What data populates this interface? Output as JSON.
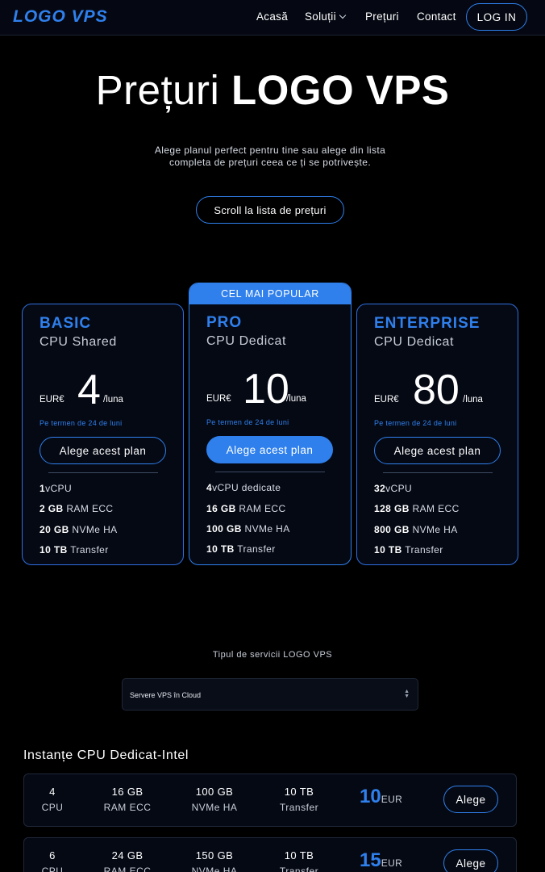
{
  "brand": {
    "logo": "LOGO VPS",
    "accent": "#2f80ed"
  },
  "nav": {
    "items": [
      {
        "label": "Acasă"
      },
      {
        "label": "Soluții"
      },
      {
        "label": "Prețuri"
      },
      {
        "label": "Contact"
      }
    ],
    "login_label": "LOG IN"
  },
  "hero": {
    "title_light": "Prețuri",
    "title_bold": "LOGO VPS",
    "subtitle": "Alege planul perfect pentru tine sau alege din lista completa de prețuri ceea ce ți se potrivește.",
    "scroll_button": "Scroll la lista de prețuri"
  },
  "plans": [
    {
      "name": "BASIC",
      "type": "CPU Shared",
      "currency": "EUR€",
      "price": "4",
      "period": "/luna",
      "term": "Pe termen de 24 de luni",
      "button": "Alege acest plan",
      "features": [
        {
          "value": "1",
          "label": "vCPU"
        },
        {
          "value": "2 GB",
          "label": "RAM ECC"
        },
        {
          "value": "20 GB",
          "label": "NVMe HA"
        },
        {
          "value": "10 TB",
          "label": "Transfer"
        }
      ]
    },
    {
      "badge": "CEL MAI POPULAR",
      "name": "PRO",
      "type": "CPU Dedicat",
      "currency": "EUR€",
      "price": "10",
      "period": "/luna",
      "term": "Pe termen de 24 de luni",
      "button": "Alege acest plan",
      "features": [
        {
          "value": "4",
          "label": "vCPU dedicate"
        },
        {
          "value": "16 GB",
          "label": "RAM ECC"
        },
        {
          "value": "100 GB",
          "label": "NVMe HA"
        },
        {
          "value": "10 TB",
          "label": "Transfer"
        }
      ]
    },
    {
      "name": "ENTERPRISE",
      "type": "CPU Dedicat",
      "currency": "EUR€",
      "price": "80",
      "period": "/luna",
      "term": "Pe termen de 24 de luni",
      "button": "Alege acest plan",
      "features": [
        {
          "value": "32",
          "label": "vCPU"
        },
        {
          "value": "128 GB",
          "label": "RAM ECC"
        },
        {
          "value": "800 GB",
          "label": "NVMe HA"
        },
        {
          "value": "10 TB",
          "label": "Transfer"
        }
      ]
    }
  ],
  "services": {
    "label": "Tipul de servicii LOGO VPS",
    "selected": "Servere VPS în Cloud"
  },
  "instances": {
    "title": "Instanțe CPU Dedicat-Intel",
    "rows": [
      {
        "cpu": "4",
        "cpu_label": "CPU",
        "ram": "16 GB",
        "ram_label": "RAM ECC",
        "disk": "100 GB",
        "disk_label": "NVMe HA",
        "transfer": "10 TB",
        "transfer_label": "Transfer",
        "price": "10",
        "currency": "EUR",
        "button": "Alege"
      },
      {
        "cpu": "6",
        "cpu_label": "CPU",
        "ram": "24 GB",
        "ram_label": "RAM ECC",
        "disk": "150 GB",
        "disk_label": "NVMe HA",
        "transfer": "10 TB",
        "transfer_label": "Transfer",
        "price": "15",
        "currency": "EUR",
        "button": "Alege"
      }
    ]
  }
}
